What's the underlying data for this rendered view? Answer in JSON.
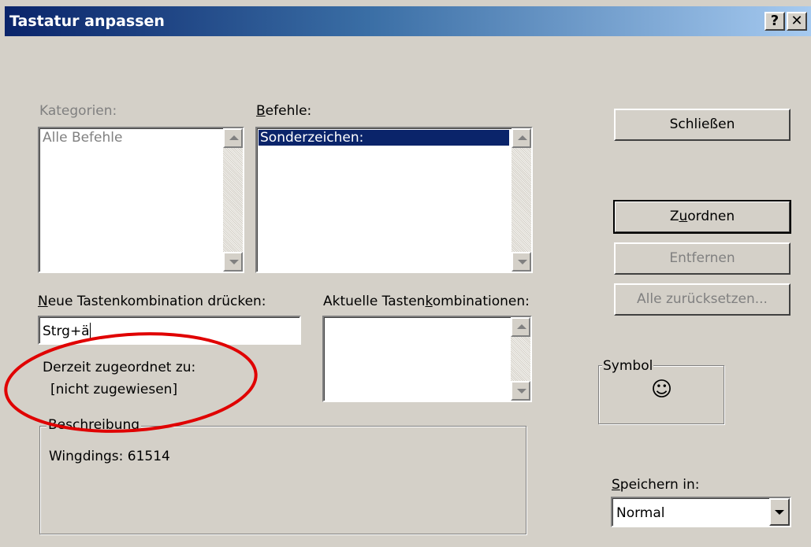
{
  "window": {
    "title": "Tastatur anpassen",
    "help_glyph": "?",
    "close_glyph": "✕"
  },
  "kategorien": {
    "label": "Kategorien:",
    "items": [
      "Alle Befehle"
    ]
  },
  "befehle": {
    "label_underlined": "B",
    "label_rest": "efehle:",
    "items": [
      "Sonderzeichen:"
    ]
  },
  "neue_tastenkombination": {
    "label_underlined": "N",
    "label_rest": "eue Tastenkombination drücken:",
    "value": "Strg+ä"
  },
  "aktuelle_tastenkombinationen": {
    "label_before": "Aktuelle Tasten",
    "label_underlined": "k",
    "label_after": "ombinationen:"
  },
  "derzeit": {
    "label": "Derzeit zugeordnet zu:",
    "value": "[nicht zugewiesen]"
  },
  "beschreibung": {
    "legend": "Beschreibung",
    "text": "Wingdings: 61514"
  },
  "buttons": {
    "schliessen": "Schließen",
    "zuordnen_before": "Z",
    "zuordnen_underlined": "u",
    "zuordnen_after": "ordnen",
    "entfernen": "Entfernen",
    "alle_zuruecksetzen": "Alle zurücksetzen..."
  },
  "symbol": {
    "legend": "Symbol",
    "glyph": "☺",
    "icon": "smiley-icon"
  },
  "speichern": {
    "label_underlined": "S",
    "label_rest": "peichern in:",
    "value": "Normal"
  },
  "colors": {
    "title_gradient_start": "#0a246a",
    "title_gradient_end": "#a6caf0",
    "selection": "#0a246a",
    "annotation_circle": "#e00000"
  }
}
